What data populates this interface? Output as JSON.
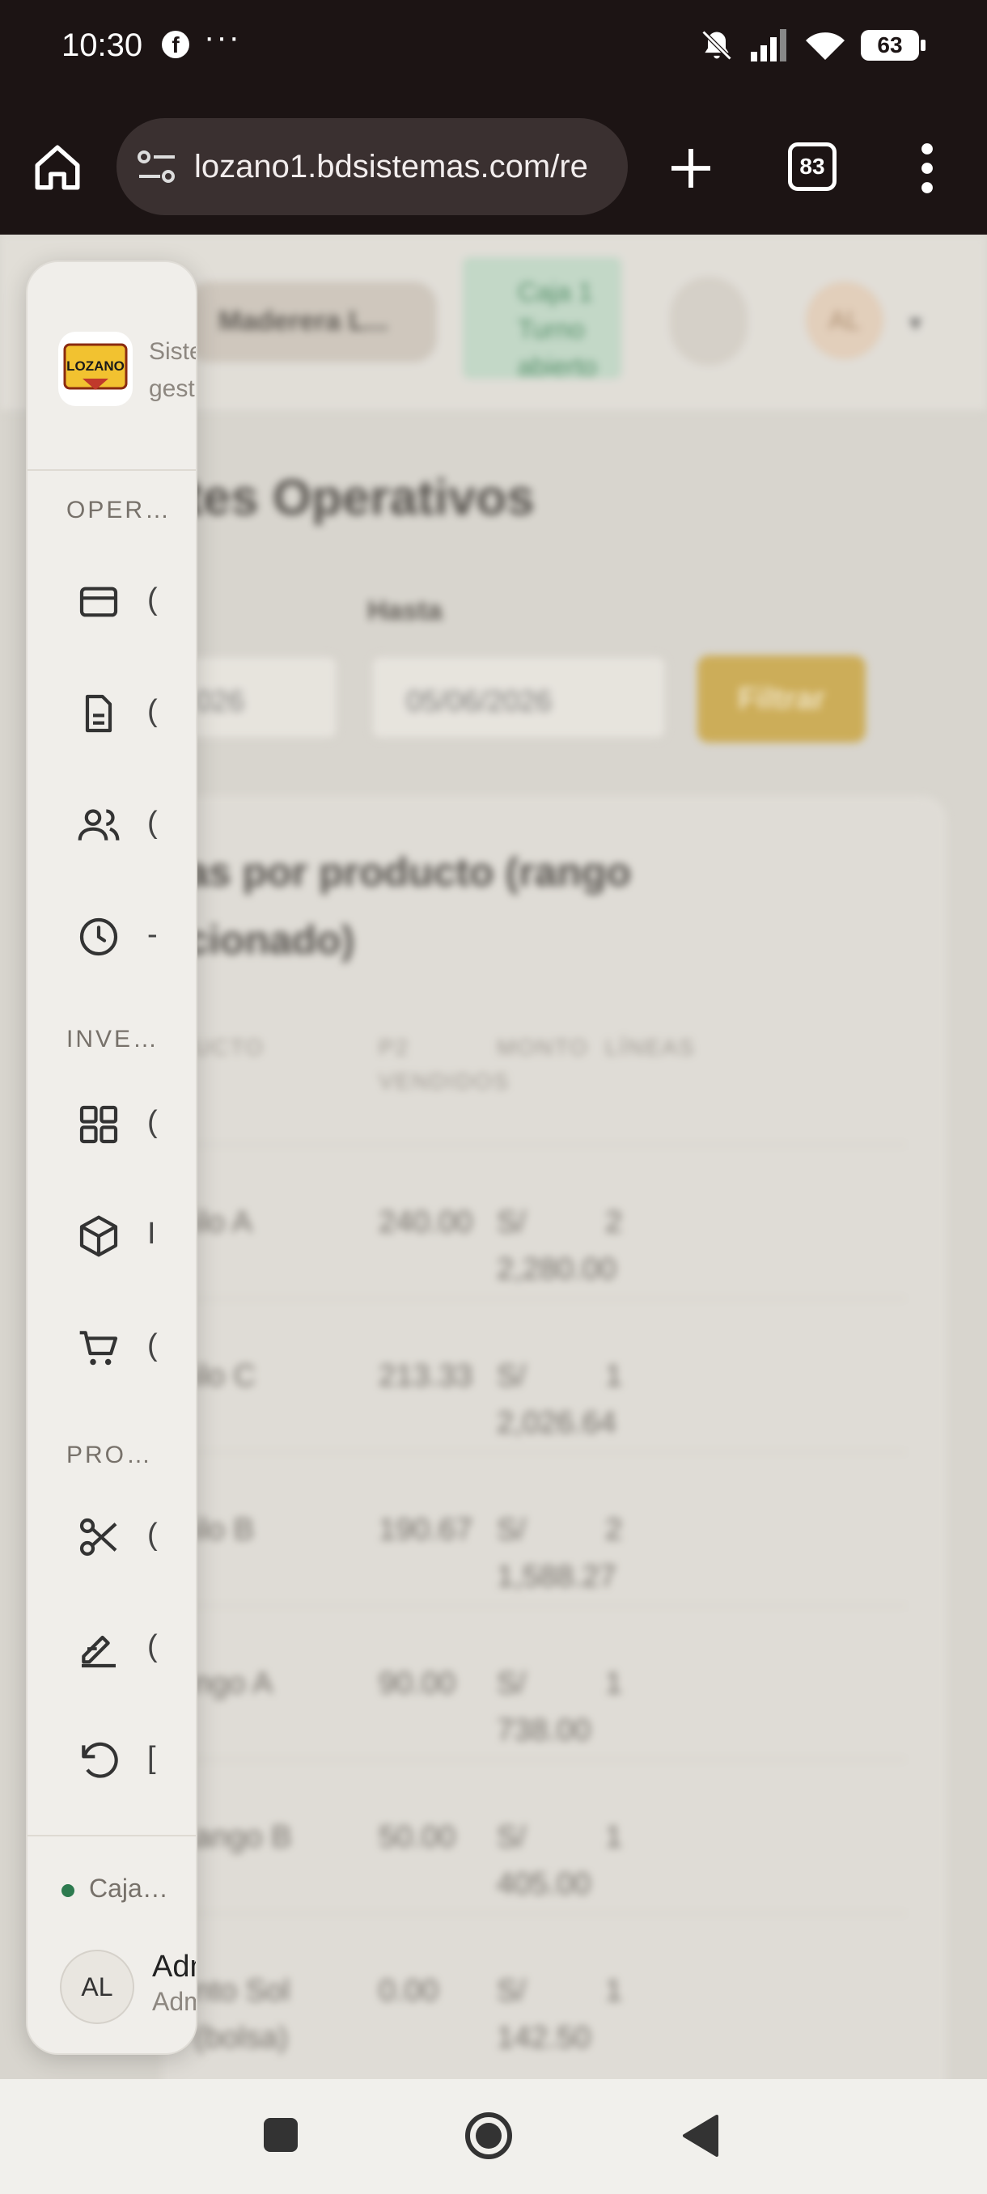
{
  "status_bar": {
    "time": "10:30",
    "fb_glyph": "f",
    "dots": "···",
    "battery": "63"
  },
  "browser": {
    "url": "lozano1.bdsistemas.com/re",
    "tab_count": "83"
  },
  "page": {
    "branch": "Maderera L...",
    "cash_status": [
      "Caja 1",
      "Turno",
      "abierto"
    ],
    "avatar": "AL",
    "title": "tes Operativos",
    "hasta_label": "Hasta",
    "date_from": "026",
    "date_to": "05/06/2026",
    "filter_button": "Filtrar",
    "card_title": "as por producto (rango cionado)",
    "table": {
      "headers": [
        "UCTO",
        "P2 VENDIDOS",
        "MONTO",
        "LÍNEAS"
      ],
      "rows": [
        [
          "ilo A",
          "240.00",
          "S/ 2,280.00",
          "2"
        ],
        [
          "ilo C",
          "213.33",
          "S/ 2,026.64",
          "1"
        ],
        [
          "ilo B",
          "190.67",
          "S/ 1,588.27",
          "2"
        ],
        [
          "ngo A",
          "90.00",
          "S/ 738.00",
          "1"
        ],
        [
          "ango B",
          "50.00",
          "S/ 405.00",
          "1"
        ],
        [
          "nto Sol (bolsa)",
          "0.00",
          "S/ 142.50",
          "1"
        ]
      ]
    }
  },
  "sidebar": {
    "logo_text": "LOZANO",
    "brand_text": "Siste de gest",
    "sections": [
      {
        "label": "OPER…",
        "items": [
          {
            "icon": "card-icon",
            "label": "("
          },
          {
            "icon": "document-icon",
            "label": "("
          },
          {
            "icon": "users-icon",
            "label": "("
          },
          {
            "icon": "clock-icon",
            "label": "-"
          }
        ]
      },
      {
        "label": "INVE…",
        "items": [
          {
            "icon": "grid-icon",
            "label": "("
          },
          {
            "icon": "box-icon",
            "label": "I"
          },
          {
            "icon": "cart-icon",
            "label": "("
          }
        ]
      },
      {
        "label": "PRO…",
        "items": [
          {
            "icon": "scissors-icon",
            "label": "("
          },
          {
            "icon": "edit-icon",
            "label": "("
          },
          {
            "icon": "undo-icon",
            "label": "["
          }
        ]
      }
    ],
    "caja": "Caja…",
    "user_initials": "AL",
    "user_name": "Adm",
    "user_role": "Adm"
  }
}
